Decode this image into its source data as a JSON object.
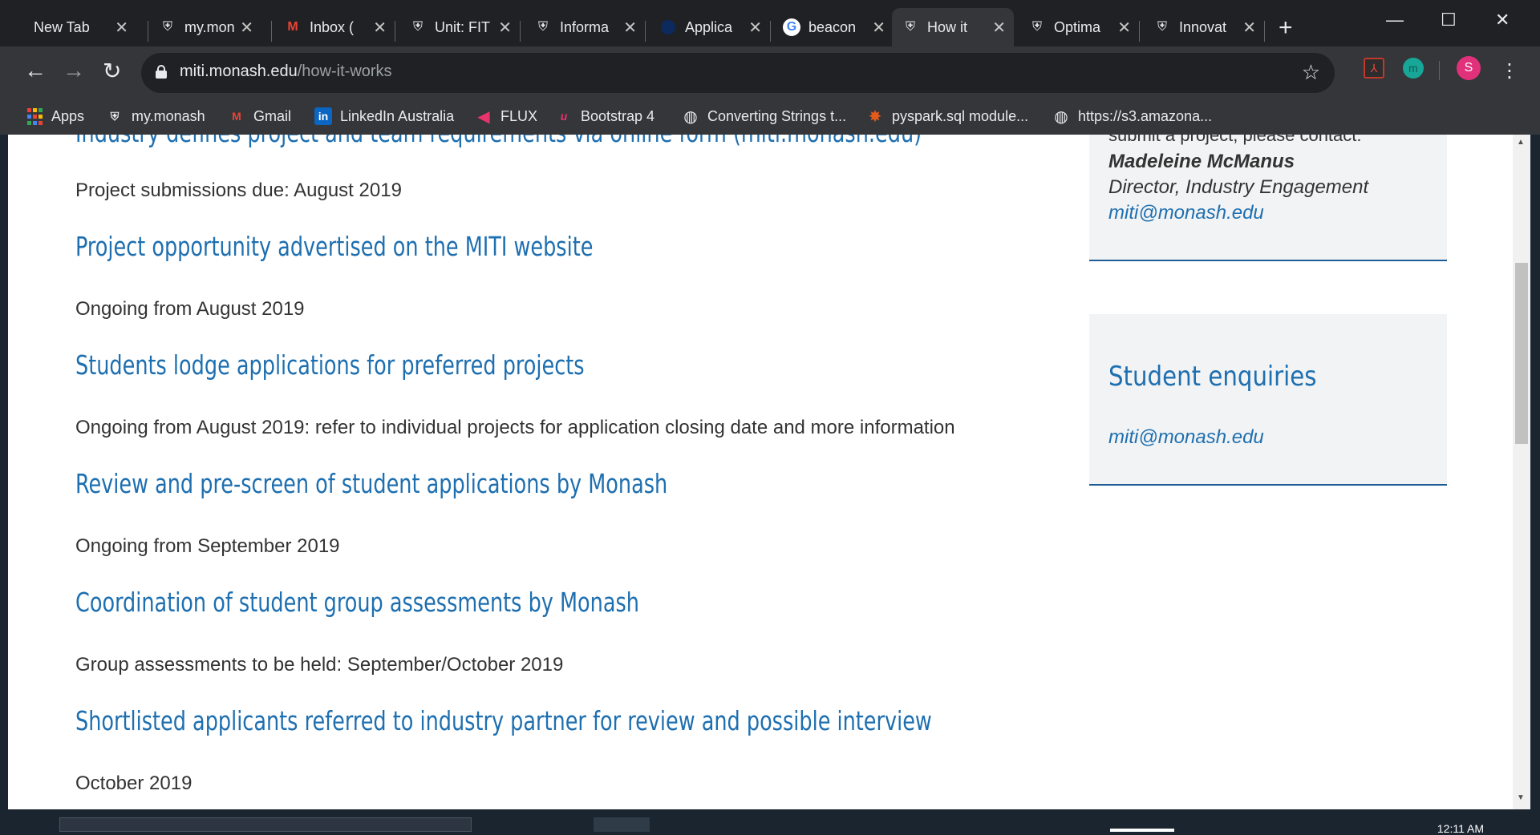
{
  "tabs": [
    {
      "label": "New Tab",
      "icon": "none"
    },
    {
      "label": "my.mon",
      "icon": "monash-shield-icon"
    },
    {
      "label": "Inbox (",
      "icon": "gmail-icon"
    },
    {
      "label": "Unit: FIT",
      "icon": "monash-shield-icon"
    },
    {
      "label": "Informa",
      "icon": "monash-shield-icon"
    },
    {
      "label": "Applica",
      "icon": "globe-dark-icon"
    },
    {
      "label": "beacon",
      "icon": "google-icon"
    },
    {
      "label": "How it",
      "icon": "monash-shield-icon",
      "active": true
    },
    {
      "label": "Optima",
      "icon": "monash-shield-icon"
    },
    {
      "label": "Innovat",
      "icon": "monash-shield-icon"
    }
  ],
  "window_controls": {
    "minimize": "—",
    "maximize": "☐",
    "close": "✕"
  },
  "address_bar": {
    "domain": "miti.monash.edu",
    "path": "/how-it-works"
  },
  "extensions": [
    {
      "name": "pdf-extension-icon",
      "color": "#c0392b",
      "text": "⅄"
    },
    {
      "name": "miti-extension-icon",
      "color": "#17a697",
      "text": "m"
    },
    {
      "name": "profile-avatar",
      "color": "#e0317a",
      "text": "S"
    }
  ],
  "bookmarks": [
    {
      "label": "Apps",
      "icon": "apps-grid-icon"
    },
    {
      "label": "my.monash",
      "icon": "monash-shield-icon"
    },
    {
      "label": "Gmail",
      "icon": "gmail-icon"
    },
    {
      "label": "LinkedIn Australia",
      "icon": "linkedin-icon"
    },
    {
      "label": "FLUX",
      "icon": "flux-icon"
    },
    {
      "label": "Bootstrap 4",
      "icon": "bootstrap-icon"
    },
    {
      "label": "Converting Strings t...",
      "icon": "globe-icon"
    },
    {
      "label": "pyspark.sql module...",
      "icon": "spark-icon"
    },
    {
      "label": "https://s3.amazona...",
      "icon": "globe-icon"
    }
  ],
  "steps": [
    {
      "title": "Industry defines project and team requirements via online form (miti.monash.edu)",
      "desc": "Project submissions due: August 2019"
    },
    {
      "title": "Project opportunity advertised on the MITI website",
      "desc": "Ongoing from August 2019"
    },
    {
      "title": "Students lodge applications for preferred projects",
      "desc": "Ongoing from August 2019: refer to individual projects for application closing date and more information"
    },
    {
      "title": "Review and pre-screen of student applications by Monash",
      "desc": "Ongoing from September 2019"
    },
    {
      "title": "Coordination of student group assessments by Monash",
      "desc": "Group assessments to be held: September/October 2019"
    },
    {
      "title": "Shortlisted applicants referred to industry partner for review and possible interview",
      "desc": "October 2019"
    }
  ],
  "contact_card": {
    "intro": "submit a project, please contact:",
    "name": "Madeleine McManus",
    "role": "Director, Industry Engagement",
    "email": "miti@monash.edu"
  },
  "student_card": {
    "heading": "Student enquiries",
    "email": "miti@monash.edu"
  },
  "taskbar": {
    "clock": "12:11 AM"
  }
}
